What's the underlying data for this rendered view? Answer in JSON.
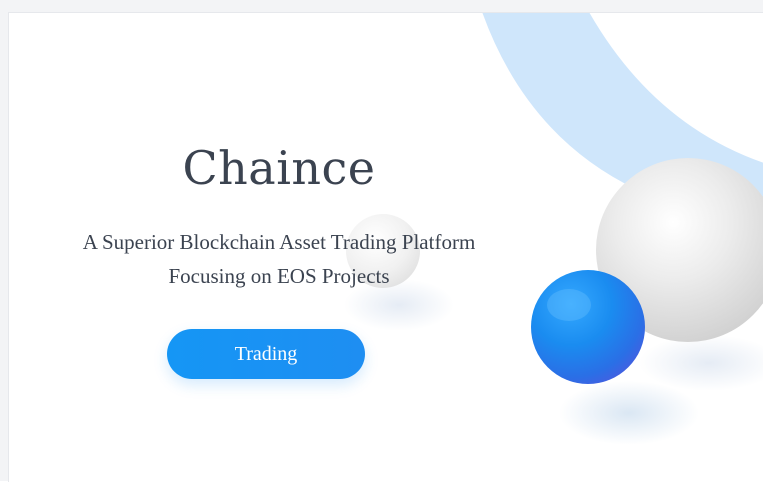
{
  "hero": {
    "title": "Chaince",
    "subtitle_line1": "A Superior Blockchain Asset Trading Platform",
    "subtitle_line2": "Focusing on EOS Projects",
    "cta_label": "Trading"
  },
  "colors": {
    "accent": "#1e8ef2",
    "text": "#3b4350",
    "arc": "#cfe6fb",
    "sphere_blue": "#1a8cf0",
    "sphere_white": "#e4e4e4"
  },
  "icons": {
    "decoration": "abstract-spheres-and-arc"
  }
}
